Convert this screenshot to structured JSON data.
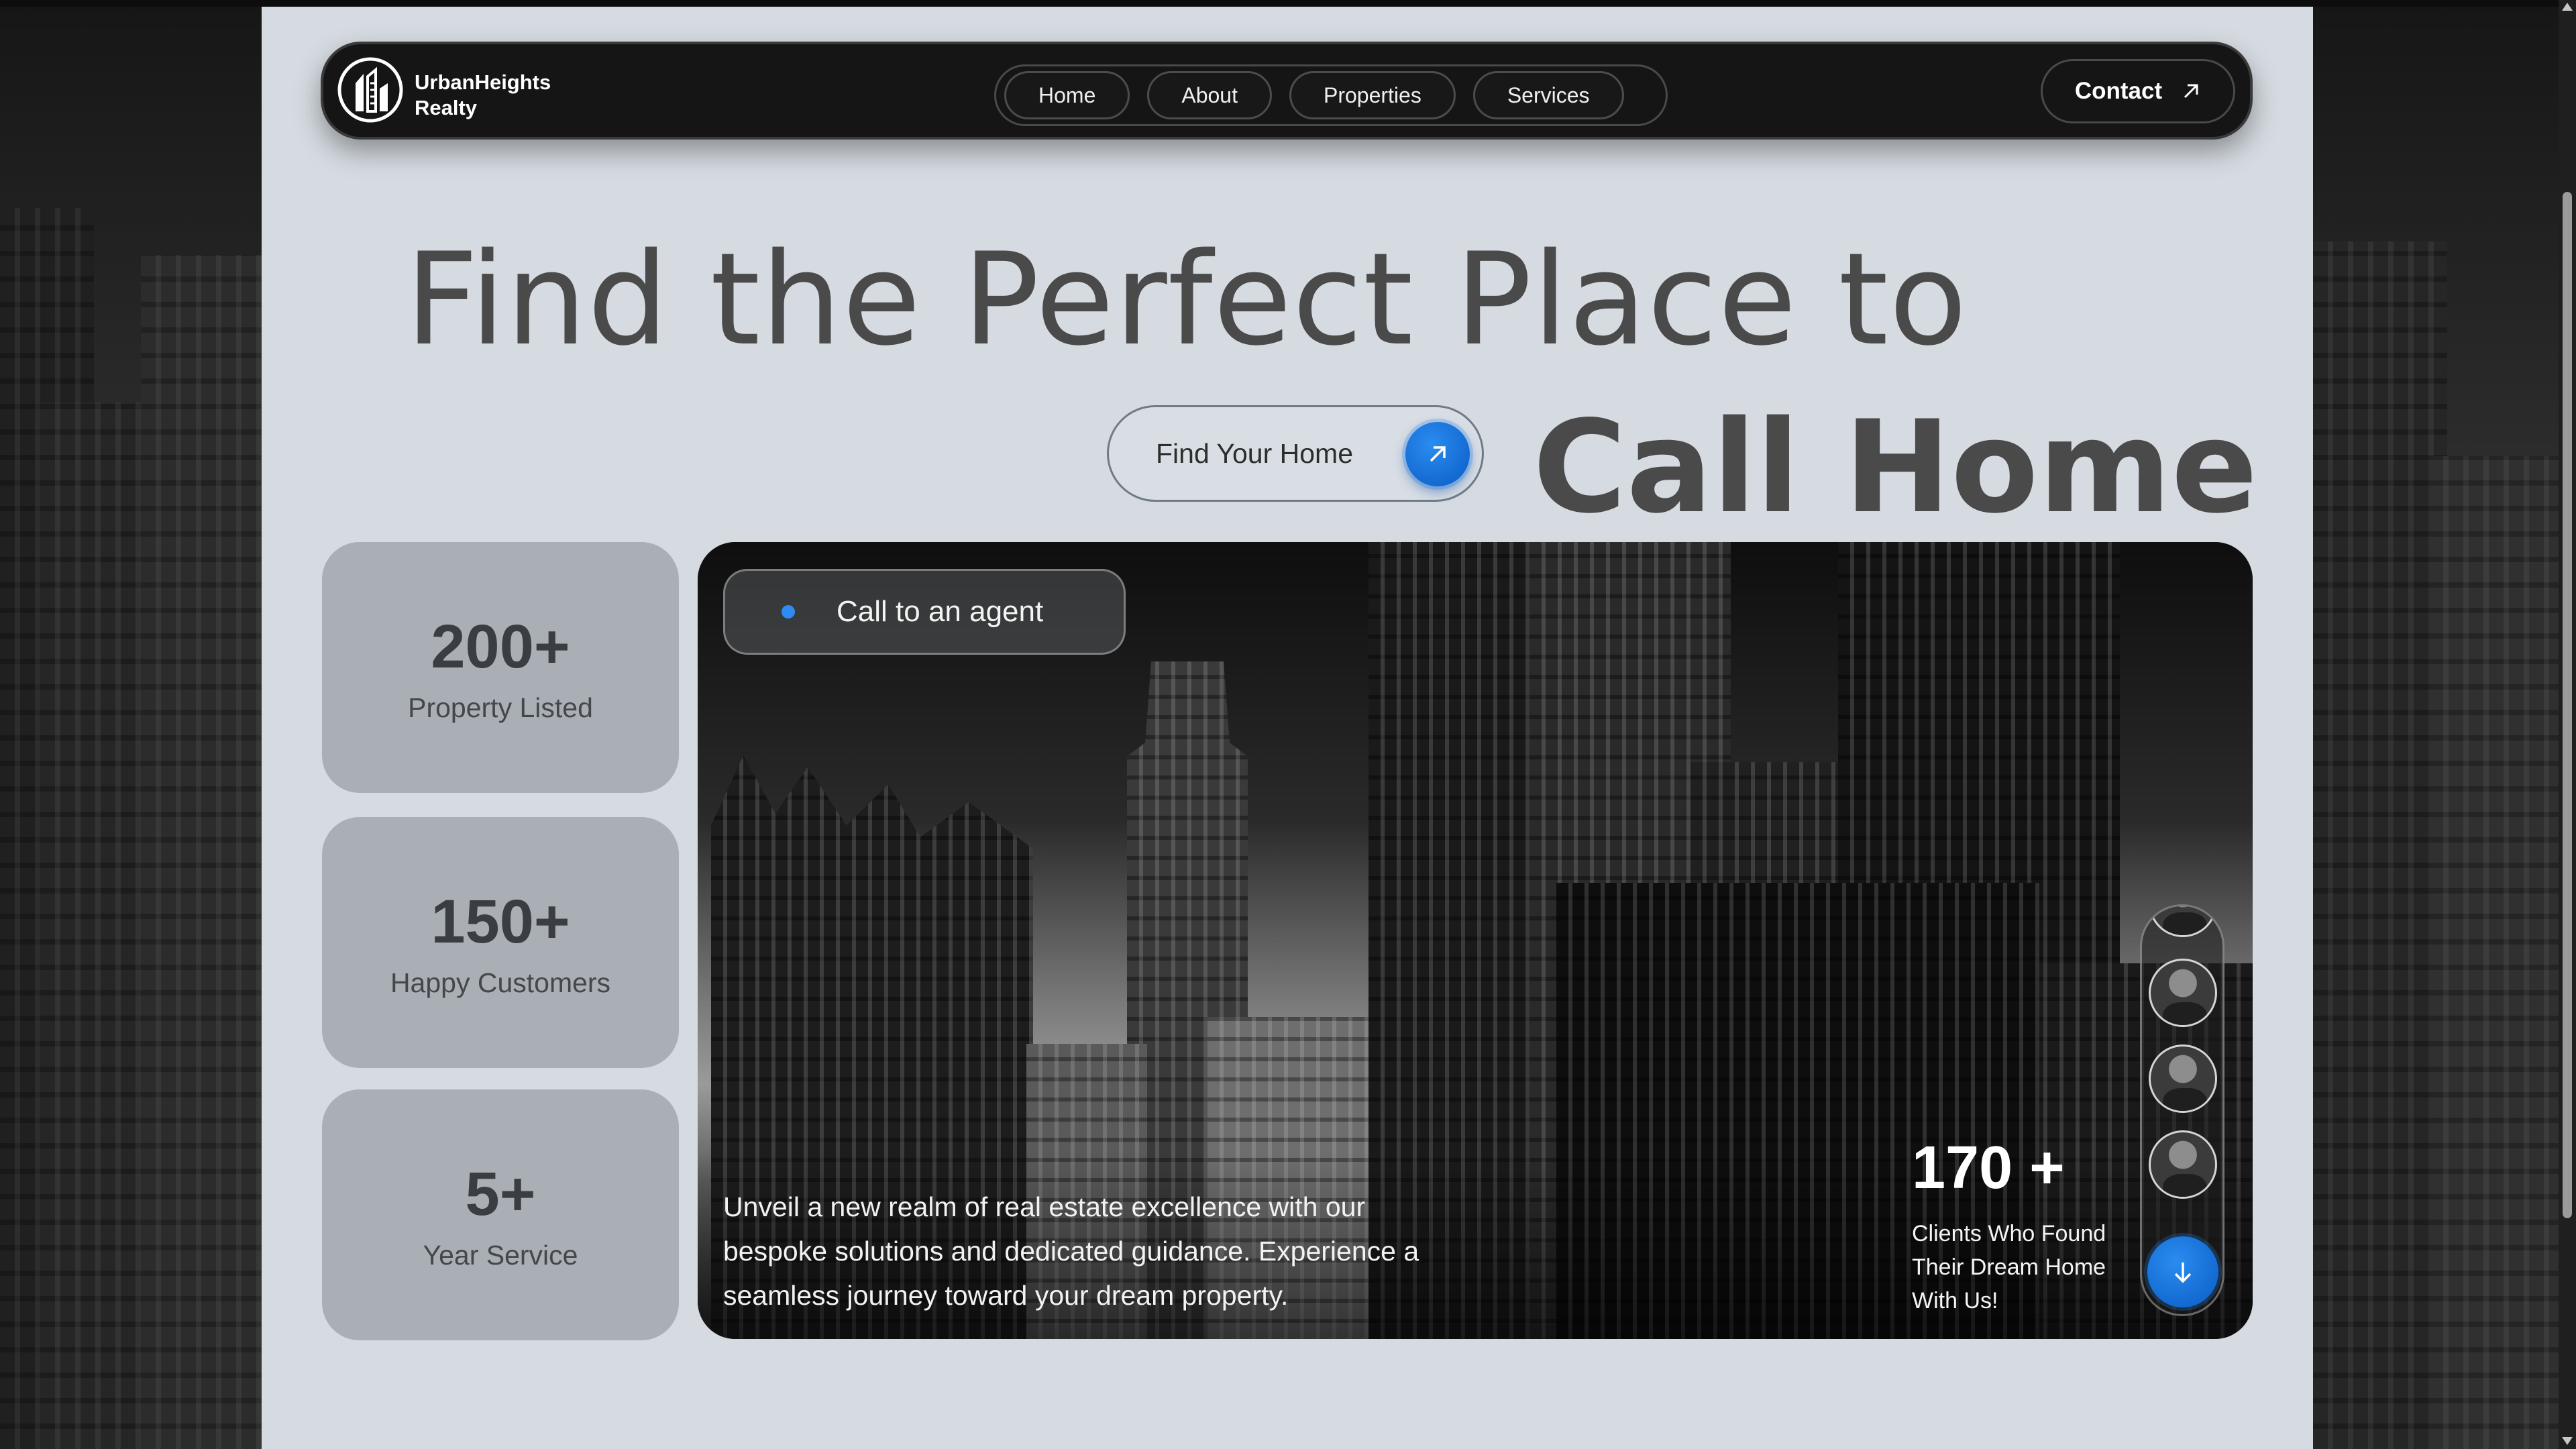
{
  "brand": {
    "line1": "UrbanHeights",
    "line2": "Realty"
  },
  "nav": {
    "links": [
      "Home",
      "About",
      "Properties",
      "Services"
    ],
    "contact_label": "Contact"
  },
  "hero": {
    "headline_line1": "Find the Perfect Place to",
    "headline_line2": "Call Home",
    "cta_label": "Find Your Home"
  },
  "stats": [
    {
      "value": "200+",
      "label": "Property Listed"
    },
    {
      "value": "150+",
      "label": "Happy Customers"
    },
    {
      "value": "5+",
      "label": "Year Service"
    }
  ],
  "panel": {
    "agent_label": "Call to an agent",
    "description": "Unveil a new realm of real estate excellence with our bespoke solutions and dedicated guidance. Experience a seamless journey toward your dream property.",
    "clients_count": "170 +",
    "clients_label": "Clients Who Found Their Dream Home With Us!"
  },
  "colors": {
    "accent": "#0a6fe0",
    "nav_bg": "#151515",
    "page_bg": "#d5dbe1",
    "stat_card": "#a9afb5",
    "headline": "#4a4a4a"
  },
  "icons": {
    "logo": "building-logo-icon",
    "contact": "arrow-up-right-icon",
    "cta": "arrow-up-right-icon",
    "scroll_down": "arrow-down-icon"
  }
}
